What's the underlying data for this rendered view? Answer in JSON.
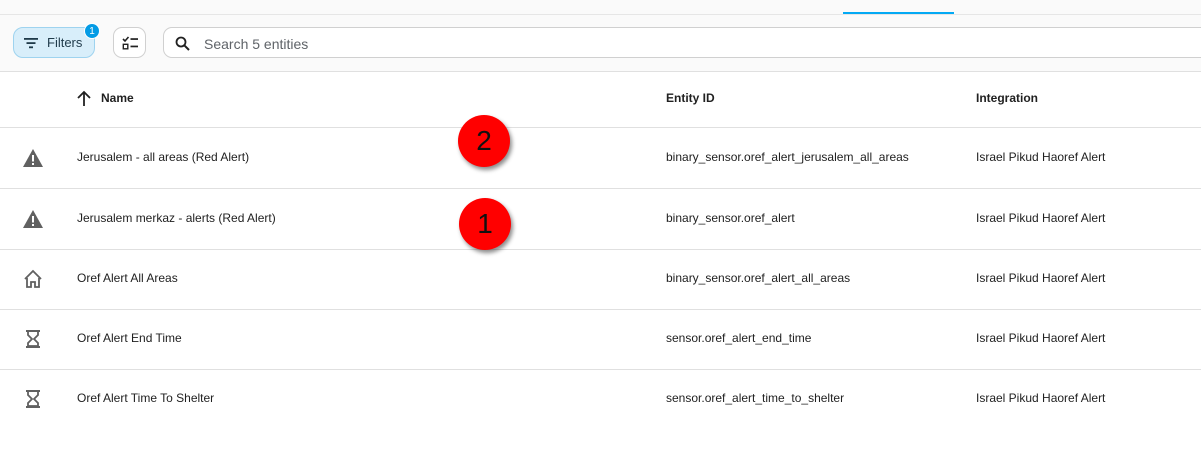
{
  "toolbar": {
    "filters_label": "Filters",
    "filters_badge": "1",
    "search_placeholder": "Search 5 entities",
    "search_value": ""
  },
  "table": {
    "columns": [
      {
        "label": "Name",
        "sort": "ascending"
      },
      {
        "label": "Entity ID"
      },
      {
        "label": "Integration"
      }
    ],
    "rows": [
      {
        "icon": "alert-triangle-icon",
        "name": "Jerusalem - all areas (Red Alert)",
        "entity_id": "binary_sensor.oref_alert_jerusalem_all_areas",
        "integration": "Israel Pikud Haoref Alert"
      },
      {
        "icon": "alert-triangle-icon",
        "name": "Jerusalem merkaz - alerts (Red Alert)",
        "entity_id": "binary_sensor.oref_alert",
        "integration": "Israel Pikud Haoref Alert"
      },
      {
        "icon": "home-outline-icon",
        "name": "Oref Alert All Areas",
        "entity_id": "binary_sensor.oref_alert_all_areas",
        "integration": "Israel Pikud Haoref Alert"
      },
      {
        "icon": "hourglass-icon",
        "name": "Oref Alert End Time",
        "entity_id": "sensor.oref_alert_end_time",
        "integration": "Israel Pikud Haoref Alert"
      },
      {
        "icon": "hourglass-icon",
        "name": "Oref Alert Time To Shelter",
        "entity_id": "sensor.oref_alert_time_to_shelter",
        "integration": "Israel Pikud Haoref Alert"
      }
    ]
  },
  "markers": [
    "2",
    "1"
  ],
  "colors": {
    "accent": "#03a9f4",
    "filter_chip_bg": "#d8eefa",
    "marker": "#ff0000"
  }
}
